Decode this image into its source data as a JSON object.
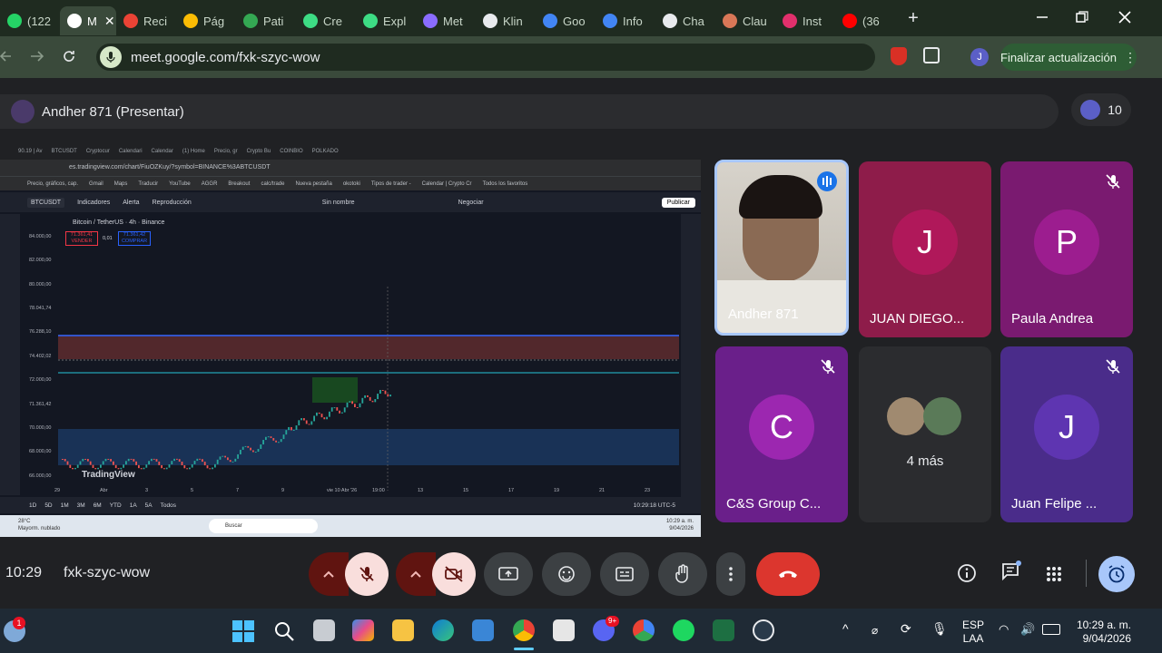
{
  "browser": {
    "tabs": [
      {
        "label": "(122",
        "color": "#25d366"
      },
      {
        "label": "M",
        "color": "#ffffff",
        "active": true
      },
      {
        "label": "Reci",
        "color": "#ea4335"
      },
      {
        "label": "Pág",
        "color": "#fbbc04"
      },
      {
        "label": "Pati",
        "color": "#34a853"
      },
      {
        "label": "Cre",
        "color": "#3ddc84"
      },
      {
        "label": "Expl",
        "color": "#3ddc84"
      },
      {
        "label": "Met",
        "color": "#8a6cff"
      },
      {
        "label": "Klin",
        "color": "#e8eaed"
      },
      {
        "label": "Goo",
        "color": "#4285f4"
      },
      {
        "label": "Info",
        "color": "#4285f4"
      },
      {
        "label": "Cha",
        "color": "#e8eaed"
      },
      {
        "label": "Clau",
        "color": "#d97757"
      },
      {
        "label": "Inst",
        "color": "#e1306c"
      },
      {
        "label": "(36",
        "color": "#ff0000"
      }
    ],
    "new_tab": "+",
    "url": "meet.google.com/fxk-szyc-wow",
    "update_button": "Finalizar actualización",
    "profile_initial": "J"
  },
  "meet": {
    "presenter_label": "Andher 871 (Presentar)",
    "participant_count": "10",
    "tiles": [
      {
        "name": "Andher 871",
        "type": "video"
      },
      {
        "name": "JUAN DIEGO...",
        "initial": "J",
        "bg": "#8e1c4a",
        "avatar": "#b0185a"
      },
      {
        "name": "Paula Andrea",
        "initial": "P",
        "bg": "#7a1a70",
        "avatar": "#9c1d8f"
      },
      {
        "name": "C&S Group C...",
        "initial": "C",
        "bg": "#6a1f8a",
        "avatar": "#9c27b0"
      },
      {
        "name": "4 más",
        "type": "more"
      },
      {
        "name": "Juan Felipe ...",
        "initial": "J",
        "bg": "#4a2c8a",
        "avatar": "#5e35b1"
      }
    ],
    "time": "10:29",
    "meeting_code": "fxk-szyc-wow"
  },
  "shared_screen": {
    "tabs": [
      "90.19 | Av",
      "BTCUSDT",
      "Cryptocur",
      "Calendari",
      "Calendar",
      "(1) Home",
      "Precio, gr",
      "Crypto Bu",
      "COINBIO",
      "POLKADO"
    ],
    "url": "es.tradingview.com/chart/FiuOZKuy/?symbol=BINANCE%3ABTCUSDT",
    "bookmarks": [
      "Precio, gráficos, cap.",
      "Gmail",
      "Maps",
      "Traducir",
      "YouTube",
      "AGGR",
      "Breakout",
      "calc/trade",
      "Nueva pestaña",
      "okotoki",
      "Tipos de trader -",
      "Calendar | Crypto Cr",
      "Todos los favoritos"
    ],
    "symbol": "BTCUSDT",
    "toolbar": [
      "Indicadores",
      "Alerta",
      "Reproducción"
    ],
    "layout_name": "Sin nombre",
    "trade_button": "Negociar",
    "publish_button": "Publicar",
    "legend": "Bitcoin / TetherUS · 4h · Binance",
    "sell_price": "71.361,41",
    "sell_label": "VENDER",
    "buy_price": "71.361,42",
    "buy_label": "COMPRAR",
    "spread": "0,01",
    "price_labels": [
      "84.000,00",
      "82.000,00",
      "80.000,00",
      "78.041,74",
      "76.288,10",
      "74.402,02",
      "72.000,00",
      "71.361,42",
      "70.000,00",
      "68.000,00",
      "66.000,00"
    ],
    "date_labels": [
      "29",
      "Abr",
      "3",
      "5",
      "7",
      "9",
      "vie 10 Abr '26",
      "19:00",
      "13",
      "15",
      "17",
      "19",
      "21",
      "23"
    ],
    "timeframes": [
      "1D",
      "5D",
      "1M",
      "3M",
      "6M",
      "YTD",
      "1A",
      "5A",
      "Todos"
    ],
    "chart_time": "10:29:18 UTC-5",
    "brand": "TradingView",
    "search_placeholder": "Buscar",
    "weather": "28°C",
    "weather_desc": "Mayorm. nublado",
    "clock_time": "10:29 a. m.",
    "clock_date": "9/04/2026"
  },
  "taskbar": {
    "badge": "1",
    "lang_top": "ESP",
    "lang_bottom": "LAA",
    "time": "10:29 a. m.",
    "date": "9/04/2026",
    "discord_badge": "9+"
  }
}
